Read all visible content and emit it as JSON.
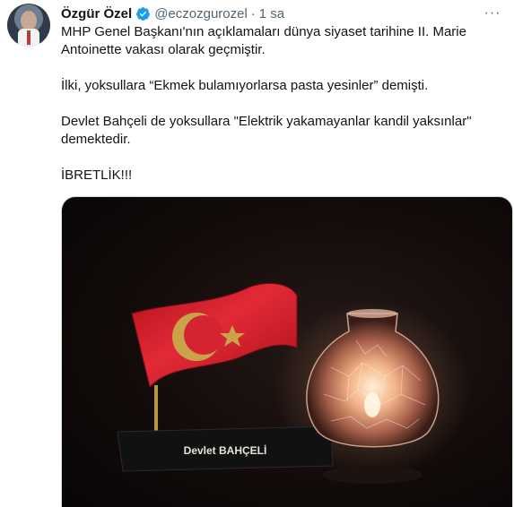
{
  "tweet": {
    "author_name": "Özgür Özel",
    "handle": "@eczozgurozel",
    "separator": "·",
    "time": "1 sa",
    "more_label": "···",
    "paragraphs": [
      "MHP Genel Başkanı'nın açıklamaları dünya siyaset tarihine II. Marie Antoinette vakası olarak geçmiştir.",
      "İlki, yoksullara “Ekmek bulamıyorlarsa pasta yesinler” demişti.",
      "Devlet Bahçeli de yoksullara   \"Elektrik yakamayanlar kandil yaksınlar\" demektedir.",
      "İBRETLİK!!!"
    ],
    "media": {
      "nameplate_text": "Devlet BAHÇELİ"
    }
  },
  "colors": {
    "verified": "#1d9bf0",
    "secondary_text": "#536471",
    "flag_red": "#d0202e",
    "emblem_gold": "#c9a24a",
    "lamp_glow": "#f3b48a"
  },
  "icons": {
    "verified": "verified-badge-icon",
    "more": "more-options-icon"
  }
}
